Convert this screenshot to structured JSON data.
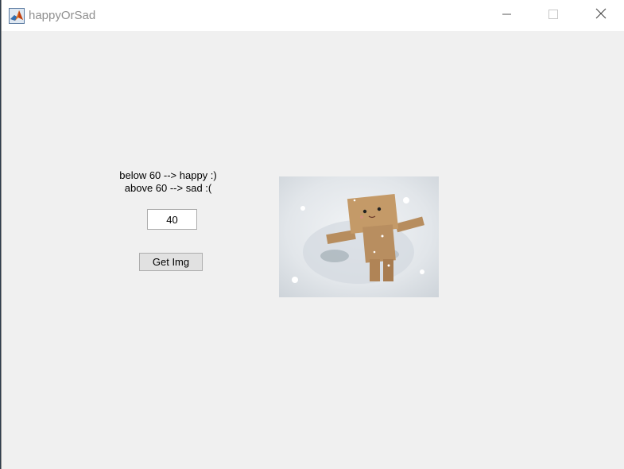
{
  "window": {
    "title": "happyOrSad",
    "icon": "matlab-icon",
    "controls": [
      "minimize-icon",
      "maximize-icon",
      "close-icon"
    ]
  },
  "main": {
    "rule_line1": "below 60 --> happy :)",
    "rule_line2": "above 60 --> sad :(",
    "input_value": "40",
    "button_label": "Get Img",
    "image": "cardboard-robot-snow-angel-photo"
  }
}
